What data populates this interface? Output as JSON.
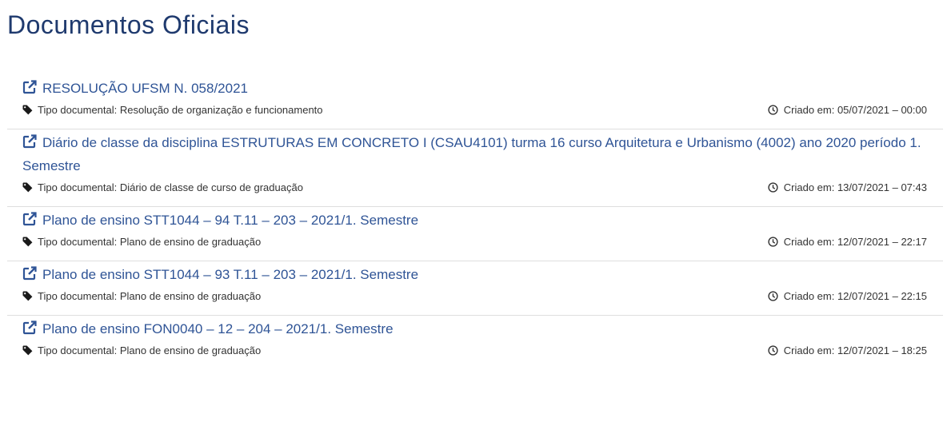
{
  "page": {
    "title": "Documentos Oficiais"
  },
  "documents": [
    {
      "title": "RESOLUÇÃO UFSM N. 058/2021",
      "type_text": "Tipo documental: Resolução de organização e funcionamento",
      "created_text": "Criado em: 05/07/2021 – 00:00"
    },
    {
      "title": "Diário de classe da disciplina ESTRUTURAS EM CONCRETO I (CSAU4101) turma 16 curso Arquitetura e Urbanismo (4002) ano 2020 período 1. Semestre",
      "type_text": "Tipo documental: Diário de classe de curso de graduação",
      "created_text": "Criado em: 13/07/2021 – 07:43"
    },
    {
      "title": "Plano de ensino STT1044 – 94 T.11 – 203 – 2021/1. Semestre",
      "type_text": "Tipo documental: Plano de ensino de graduação",
      "created_text": "Criado em: 12/07/2021 – 22:17"
    },
    {
      "title": "Plano de ensino STT1044 – 93 T.11 – 203 – 2021/1. Semestre",
      "type_text": "Tipo documental: Plano de ensino de graduação",
      "created_text": "Criado em: 12/07/2021 – 22:15"
    },
    {
      "title": "Plano de ensino FON0040 – 12 – 204 – 2021/1. Semestre",
      "type_text": "Tipo documental: Plano de ensino de graduação",
      "created_text": "Criado em: 12/07/2021 – 18:25"
    }
  ],
  "icons": {
    "link": "external-link-icon",
    "type": "tag-icon",
    "date": "clock-icon"
  },
  "colors": {
    "title": "#1f3a6e",
    "link": "#2f5496",
    "meta_text": "#333333",
    "divider": "#dedede"
  }
}
